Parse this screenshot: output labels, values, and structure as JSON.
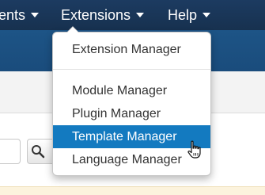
{
  "navbar": {
    "items": [
      {
        "label": "ents",
        "has_caret": true
      },
      {
        "label": "Extensions",
        "has_caret": true,
        "open": true
      },
      {
        "label": "Help",
        "has_caret": true
      }
    ]
  },
  "dropdown": {
    "items": [
      {
        "label": "Extension Manager"
      },
      {
        "label": "Module Manager"
      },
      {
        "label": "Plugin Manager"
      },
      {
        "label": "Template Manager",
        "highlighted": true
      },
      {
        "label": "Language Manager"
      }
    ]
  },
  "toolbar": {
    "search_button_icon": "search-icon"
  },
  "colors": {
    "navbar": "#1c3b61",
    "header": "#1d5486",
    "highlight": "#137ac0",
    "notice": "#fcf3dd"
  },
  "cursor": "hand-pointer-icon"
}
